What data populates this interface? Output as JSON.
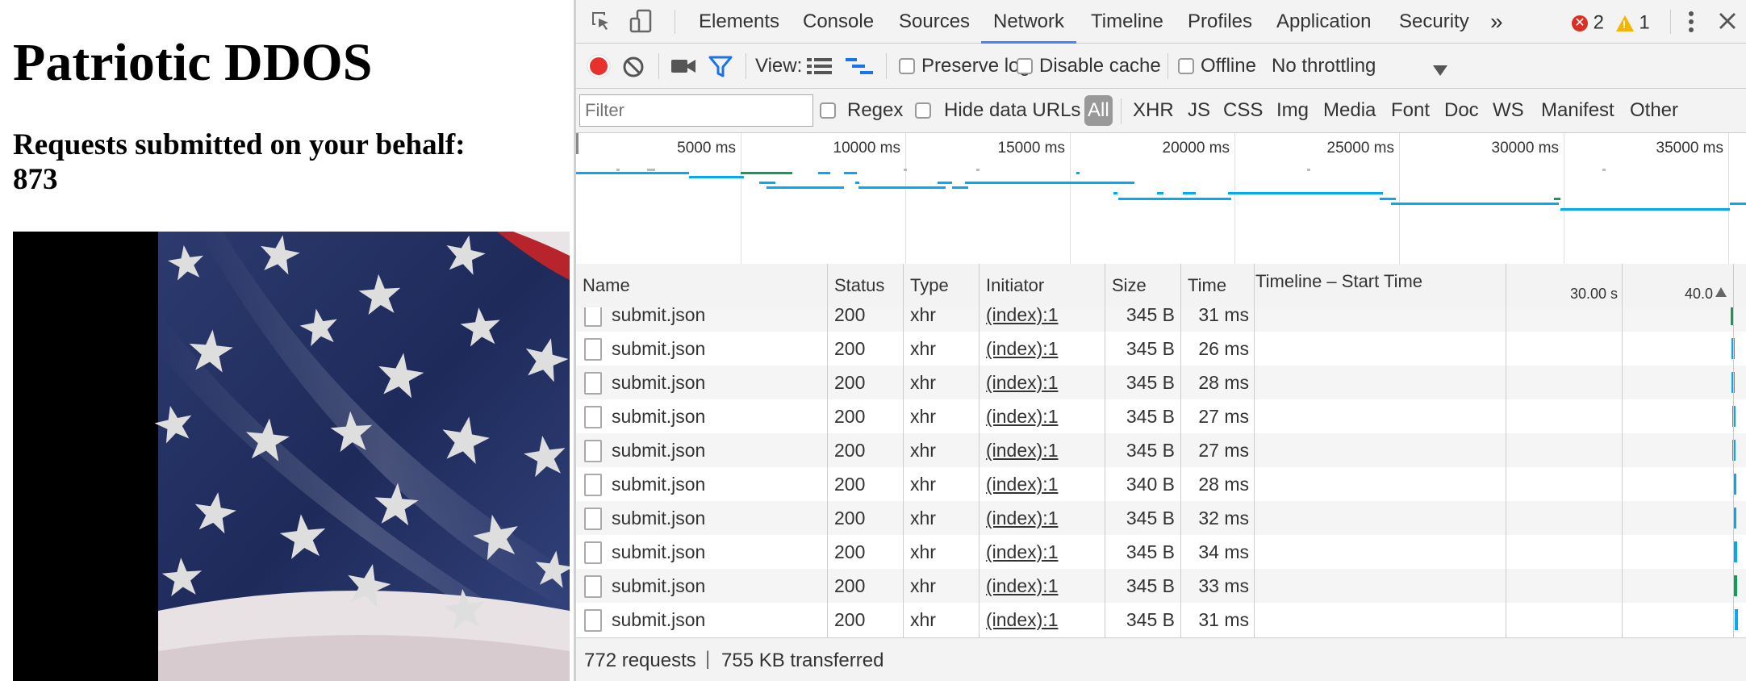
{
  "page": {
    "title": "Patriotic DDOS",
    "requests_label": "Requests submitted on your behalf:",
    "requests_count": "873"
  },
  "devtools": {
    "tabs": [
      "Elements",
      "Console",
      "Sources",
      "Network",
      "Timeline",
      "Profiles",
      "Application",
      "Security"
    ],
    "active_tab": "Network",
    "more_tabs": "»",
    "error_count": "2",
    "warning_count": "1",
    "toolbar": {
      "view_label": "View:",
      "preserve_log": "Preserve log",
      "disable_cache": "Disable cache",
      "offline": "Offline",
      "throttling": "No throttling"
    },
    "filter": {
      "placeholder": "Filter",
      "regex": "Regex",
      "hide_data_urls": "Hide data URLs",
      "types": [
        "All",
        "XHR",
        "JS",
        "CSS",
        "Img",
        "Media",
        "Font",
        "Doc",
        "WS",
        "Manifest",
        "Other"
      ],
      "active_type": "All"
    },
    "overview_ticks": [
      "5000 ms",
      "10000 ms",
      "15000 ms",
      "20000 ms",
      "25000 ms",
      "30000 ms",
      "35000 ms"
    ],
    "columns": [
      "Name",
      "Status",
      "Type",
      "Initiator",
      "Size",
      "Time",
      "Timeline – Start Time"
    ],
    "timeline_ticks": [
      "30.00 s",
      "40.0"
    ],
    "rows": [
      {
        "name": "submit.json",
        "status": "200",
        "type": "xhr",
        "initiator": "(index):1",
        "size": "345 B",
        "time": "31 ms"
      },
      {
        "name": "submit.json",
        "status": "200",
        "type": "xhr",
        "initiator": "(index):1",
        "size": "345 B",
        "time": "26 ms"
      },
      {
        "name": "submit.json",
        "status": "200",
        "type": "xhr",
        "initiator": "(index):1",
        "size": "345 B",
        "time": "28 ms"
      },
      {
        "name": "submit.json",
        "status": "200",
        "type": "xhr",
        "initiator": "(index):1",
        "size": "345 B",
        "time": "27 ms"
      },
      {
        "name": "submit.json",
        "status": "200",
        "type": "xhr",
        "initiator": "(index):1",
        "size": "345 B",
        "time": "27 ms"
      },
      {
        "name": "submit.json",
        "status": "200",
        "type": "xhr",
        "initiator": "(index):1",
        "size": "340 B",
        "time": "28 ms"
      },
      {
        "name": "submit.json",
        "status": "200",
        "type": "xhr",
        "initiator": "(index):1",
        "size": "345 B",
        "time": "32 ms"
      },
      {
        "name": "submit.json",
        "status": "200",
        "type": "xhr",
        "initiator": "(index):1",
        "size": "345 B",
        "time": "34 ms"
      },
      {
        "name": "submit.json",
        "status": "200",
        "type": "xhr",
        "initiator": "(index):1",
        "size": "345 B",
        "time": "33 ms"
      },
      {
        "name": "submit.json",
        "status": "200",
        "type": "xhr",
        "initiator": "(index):1",
        "size": "345 B",
        "time": "31 ms"
      }
    ],
    "status_bar": {
      "requests": "772 requests",
      "separator": "|",
      "transferred": "755 KB transferred"
    },
    "colors": {
      "accent": "#4285f4",
      "record": "#e8312c",
      "waterfall": "#03a9f4",
      "waterfall_green": "#0f9d58",
      "error": "#d93025",
      "warning": "#f4b400"
    }
  }
}
